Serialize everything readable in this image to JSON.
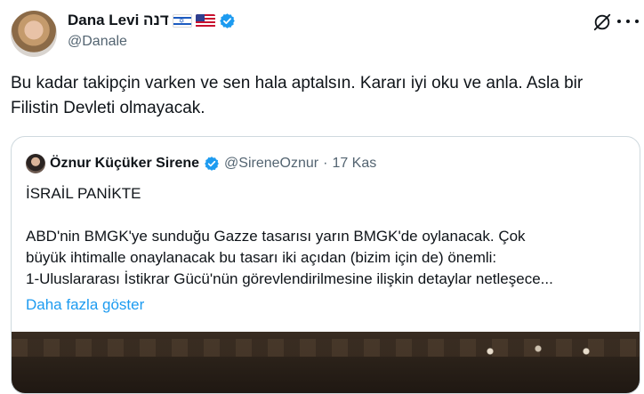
{
  "tweet": {
    "author_name": "Dana Levi דנה",
    "author_handle": "@Danale",
    "flags": [
      "israel-flag-icon",
      "us-flag-icon"
    ],
    "text": "Bu kadar takipçin varken ve sen hala aptalsın. Kararı iyi oku ve anla. Asla bir Filistin Devleti olmayacak."
  },
  "quote": {
    "author_name": "Öznur Küçüker Sirene",
    "author_handle": "@SireneOznur",
    "separator": "·",
    "date": "17 Kas",
    "lines": [
      "İSRAİL PANİKTE",
      "",
      "ABD'nin BMGK'ye sunduğu Gazze tasarısı yarın BMGK'de oylanacak. Çok",
      "büyük ihtimalle onaylanacak bu tasarı iki açıdan (bizim için de) önemli:",
      "1-Uluslararası İstikrar Gücü'nün görevlendirilmesine ilişkin detaylar netleşece..."
    ],
    "show_more": "Daha fazla göster"
  },
  "colors": {
    "accent": "#1d9bf0",
    "secondary_text": "#536471",
    "border": "#cfd9de"
  }
}
